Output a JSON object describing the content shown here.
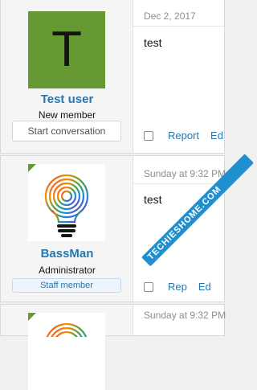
{
  "colors": {
    "link_blue": "#2577b1",
    "avatar_green": "#669933",
    "date_gray": "#8c8c8c"
  },
  "posts": [
    {
      "avatar_letter": "T",
      "username": "Test user",
      "user_title": "New member",
      "start_conversation_label": "Start conversation",
      "date": "Dec 2, 2017",
      "body": "test",
      "actions": {
        "report_label": "Report",
        "edit_label": "Ed"
      }
    },
    {
      "username": "BassMan",
      "user_title": "Administrator",
      "staff_badge": "Staff member",
      "date": "Sunday at 9:32 PM",
      "body": "test",
      "actions": {
        "report_label": "Rep",
        "edit_label": "Ed"
      }
    },
    {
      "date": "Sunday at 9:32 PM"
    }
  ],
  "watermark": "TECHIESHOME.COM"
}
